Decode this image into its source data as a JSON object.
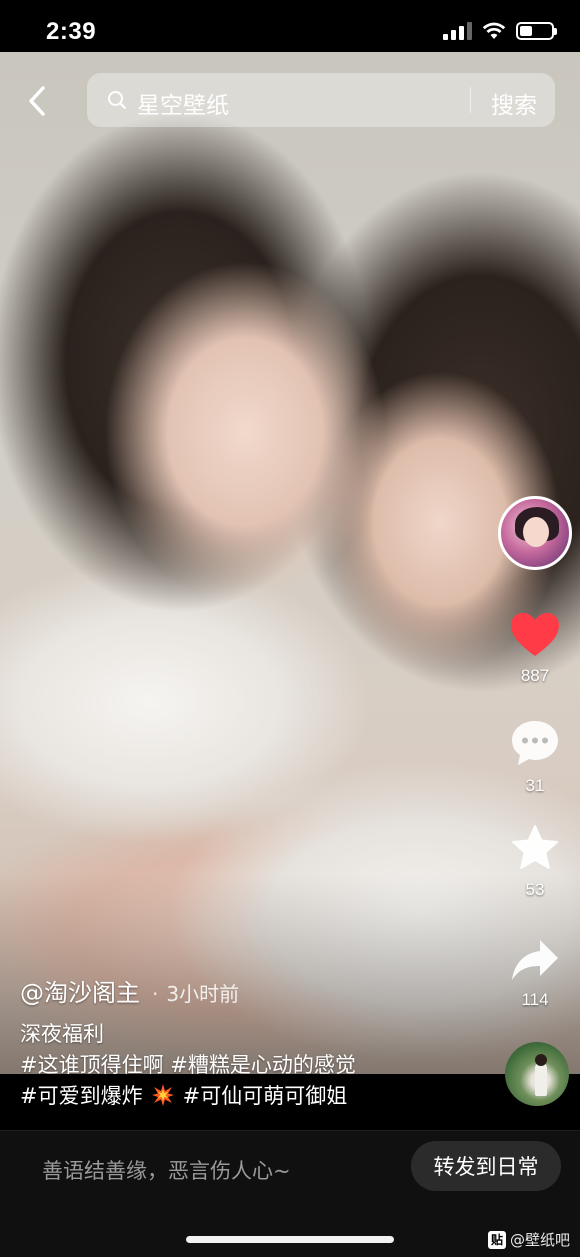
{
  "status_bar": {
    "time": "2:39"
  },
  "search": {
    "query": "星空壁纸",
    "button_label": "搜索"
  },
  "actions": {
    "like_count": "887",
    "comment_count": "31",
    "favorite_count": "53",
    "share_count": "114"
  },
  "post": {
    "author": "@淘沙阁主",
    "separator": "·",
    "time_ago": "3小时前",
    "description": "深夜福利",
    "tags_line1": "#这谁顶得住啊 #糟糕是心动的感觉",
    "tags_line2_a": "#可爱到爆炸",
    "tags_line2_b": "#可仙可萌可御姐"
  },
  "bottom": {
    "comment_placeholder": "善语结善缘，恶言伤人心~",
    "repost_label": "转发到日常"
  },
  "watermark": {
    "badge": "贴",
    "text": "@壁纸吧"
  },
  "colors": {
    "like": "#ff3b47",
    "background": "#000000",
    "repost_bg": "#2b2b2b"
  }
}
